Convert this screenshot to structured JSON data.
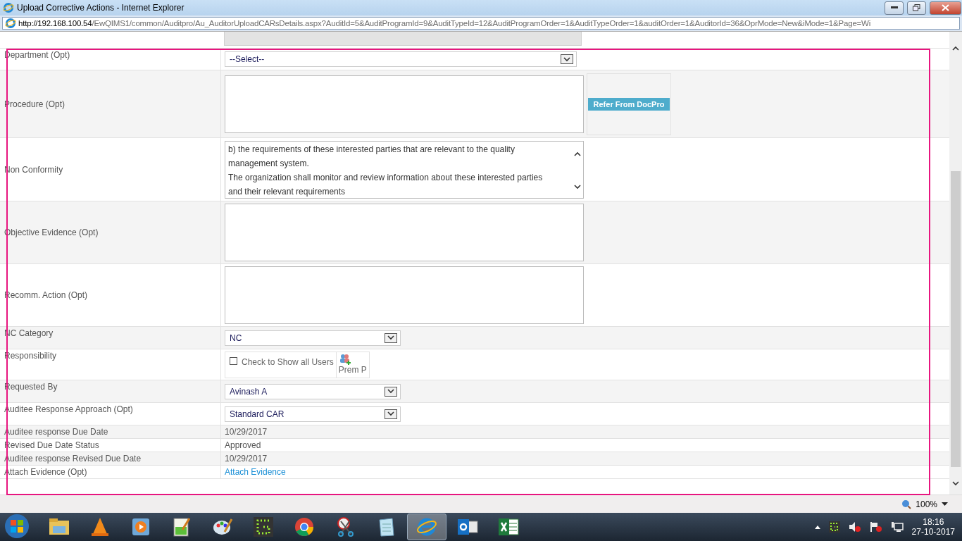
{
  "window": {
    "title": "Upload Corrective Actions - Internet Explorer",
    "url_host": "http://192.168.100.54",
    "url_rest": "/EwQIMS1/common/Auditpro/Au_AuditorUploadCARsDetails.aspx?AuditId=5&AuditProgramId=9&AuditTypeId=12&AuditProgramOrder=1&AuditTypeOrder=1&auditOrder=1&AuditorId=36&OprMode=New&iMode=1&Page=Wi"
  },
  "form": [
    {
      "label": "Department (Opt)",
      "kind": "select",
      "value": "--Select--",
      "wide": true
    },
    {
      "label": "Procedure (Opt)",
      "kind": "textarea_button",
      "button": "Refer From DocPro"
    },
    {
      "label": "Non Conformity",
      "kind": "textarea",
      "lines": [
        "b) the requirements of these interested parties that are relevant to the quality management system.",
        "The organization shall monitor and review information about these interested parties and their relevant requirements"
      ]
    },
    {
      "label": "Objective Evidence (Opt)",
      "kind": "textarea"
    },
    {
      "label": "Recomm. Action (Opt)",
      "kind": "textarea"
    },
    {
      "label": "NC Category",
      "kind": "select",
      "value": "NC",
      "wide": false
    },
    {
      "label": "Responsibility",
      "kind": "responsibility",
      "checkbox_label": "Check to Show all Users",
      "checked": false,
      "user": "Prem P"
    },
    {
      "label": "Requested By",
      "kind": "select",
      "value": "Avinash A",
      "wide": false
    },
    {
      "label": "Auditee Response Approach (Opt)",
      "kind": "select",
      "value": "Standard CAR",
      "wide": false
    },
    {
      "label": "Auditee response Due Date",
      "kind": "text",
      "value": "10/29/2017"
    },
    {
      "label": "Revised Due Date Status",
      "kind": "text",
      "value": "Approved"
    },
    {
      "label": "Auditee response Revised Due Date",
      "kind": "text",
      "value": "10/29/2017"
    },
    {
      "label": "Attach Evidence (Opt)",
      "kind": "link",
      "value": "Attach Evidence"
    }
  ],
  "status_bar": {
    "zoom": "100%"
  },
  "taskbar": {
    "apps": [
      {
        "kind": "folder",
        "selected": false
      },
      {
        "kind": "cone",
        "selected": false
      },
      {
        "kind": "player",
        "selected": false
      },
      {
        "kind": "editor",
        "selected": false
      },
      {
        "kind": "palette",
        "selected": false
      },
      {
        "kind": "dots",
        "selected": false
      },
      {
        "kind": "chrome",
        "selected": false
      },
      {
        "kind": "scissors",
        "selected": false
      },
      {
        "kind": "notepad",
        "selected": false
      },
      {
        "kind": "ie",
        "selected": true
      },
      {
        "kind": "mail",
        "selected": false
      },
      {
        "kind": "sheet",
        "selected": false
      }
    ],
    "time": "18:16",
    "date": "27-10-2017"
  }
}
